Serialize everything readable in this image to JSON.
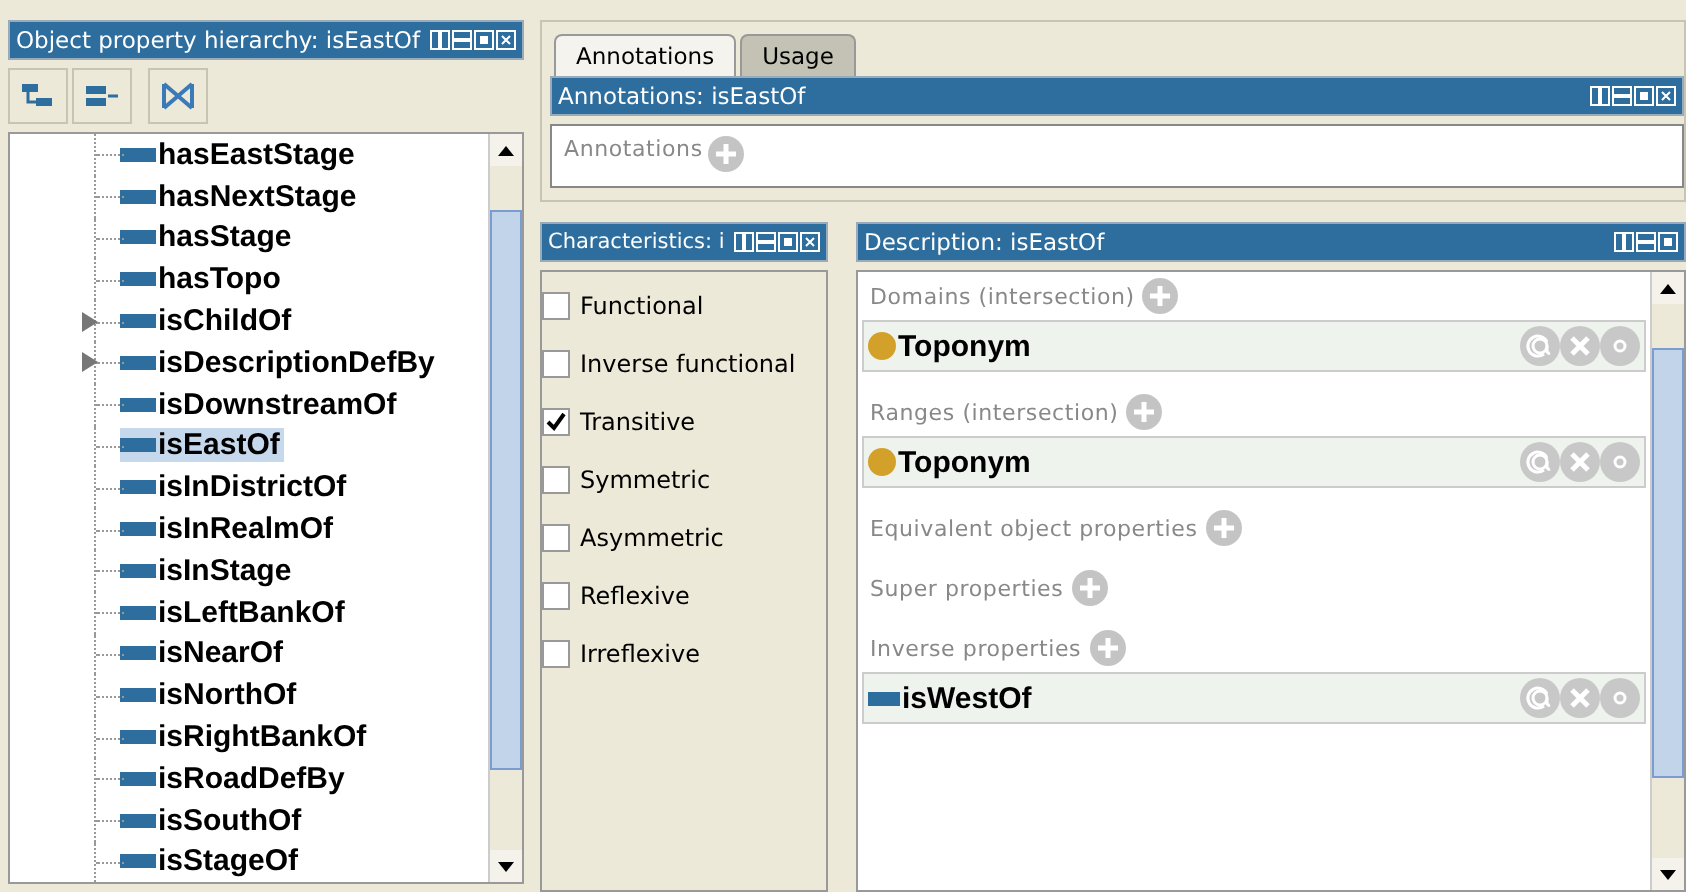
{
  "hierarchy": {
    "title": "Object property hierarchy: isEastOf",
    "items": [
      {
        "name": "hasEastStage",
        "expandable": false,
        "selected": false
      },
      {
        "name": "hasNextStage",
        "expandable": false,
        "selected": false
      },
      {
        "name": "hasStage",
        "expandable": false,
        "selected": false
      },
      {
        "name": "hasTopo",
        "expandable": false,
        "selected": false
      },
      {
        "name": "isChildOf",
        "expandable": true,
        "selected": false
      },
      {
        "name": "isDescriptionDefBy",
        "expandable": true,
        "selected": false
      },
      {
        "name": "isDownstreamOf",
        "expandable": false,
        "selected": false
      },
      {
        "name": "isEastOf",
        "expandable": false,
        "selected": true
      },
      {
        "name": "isInDistrictOf",
        "expandable": false,
        "selected": false
      },
      {
        "name": "isInRealmOf",
        "expandable": false,
        "selected": false
      },
      {
        "name": "isInStage",
        "expandable": false,
        "selected": false
      },
      {
        "name": "isLeftBankOf",
        "expandable": false,
        "selected": false
      },
      {
        "name": "isNearOf",
        "expandable": false,
        "selected": false
      },
      {
        "name": "isNorthOf",
        "expandable": false,
        "selected": false
      },
      {
        "name": "isRightBankOf",
        "expandable": false,
        "selected": false
      },
      {
        "name": "isRoadDefBy",
        "expandable": false,
        "selected": false
      },
      {
        "name": "isSouthOf",
        "expandable": false,
        "selected": false
      },
      {
        "name": "isStageOf",
        "expandable": false,
        "selected": false
      }
    ]
  },
  "tabs": [
    {
      "label": "Annotations",
      "selected": true
    },
    {
      "label": "Usage",
      "selected": false
    }
  ],
  "annotations": {
    "title": "Annotations: isEastOf",
    "label": "Annotations"
  },
  "characteristics": {
    "title": "Characteristics: i",
    "items": [
      {
        "label": "Functional",
        "checked": false
      },
      {
        "label": "Inverse functional",
        "checked": false
      },
      {
        "label": "Transitive",
        "checked": true
      },
      {
        "label": "Symmetric",
        "checked": false
      },
      {
        "label": "Asymmetric",
        "checked": false
      },
      {
        "label": "Reflexive",
        "checked": false
      },
      {
        "label": "Irreflexive",
        "checked": false
      }
    ]
  },
  "description": {
    "title": "Description: isEastOf",
    "sections": [
      {
        "label": "Domains (intersection)",
        "items": [
          {
            "name": "Toponym",
            "kind": "class"
          }
        ]
      },
      {
        "label": "Ranges (intersection)",
        "items": [
          {
            "name": "Toponym",
            "kind": "class"
          }
        ]
      },
      {
        "label": "Equivalent object properties"
      },
      {
        "label": "Super properties"
      },
      {
        "label": "Inverse properties",
        "items": [
          {
            "name": "isWestOf",
            "kind": "property"
          }
        ]
      }
    ]
  }
}
